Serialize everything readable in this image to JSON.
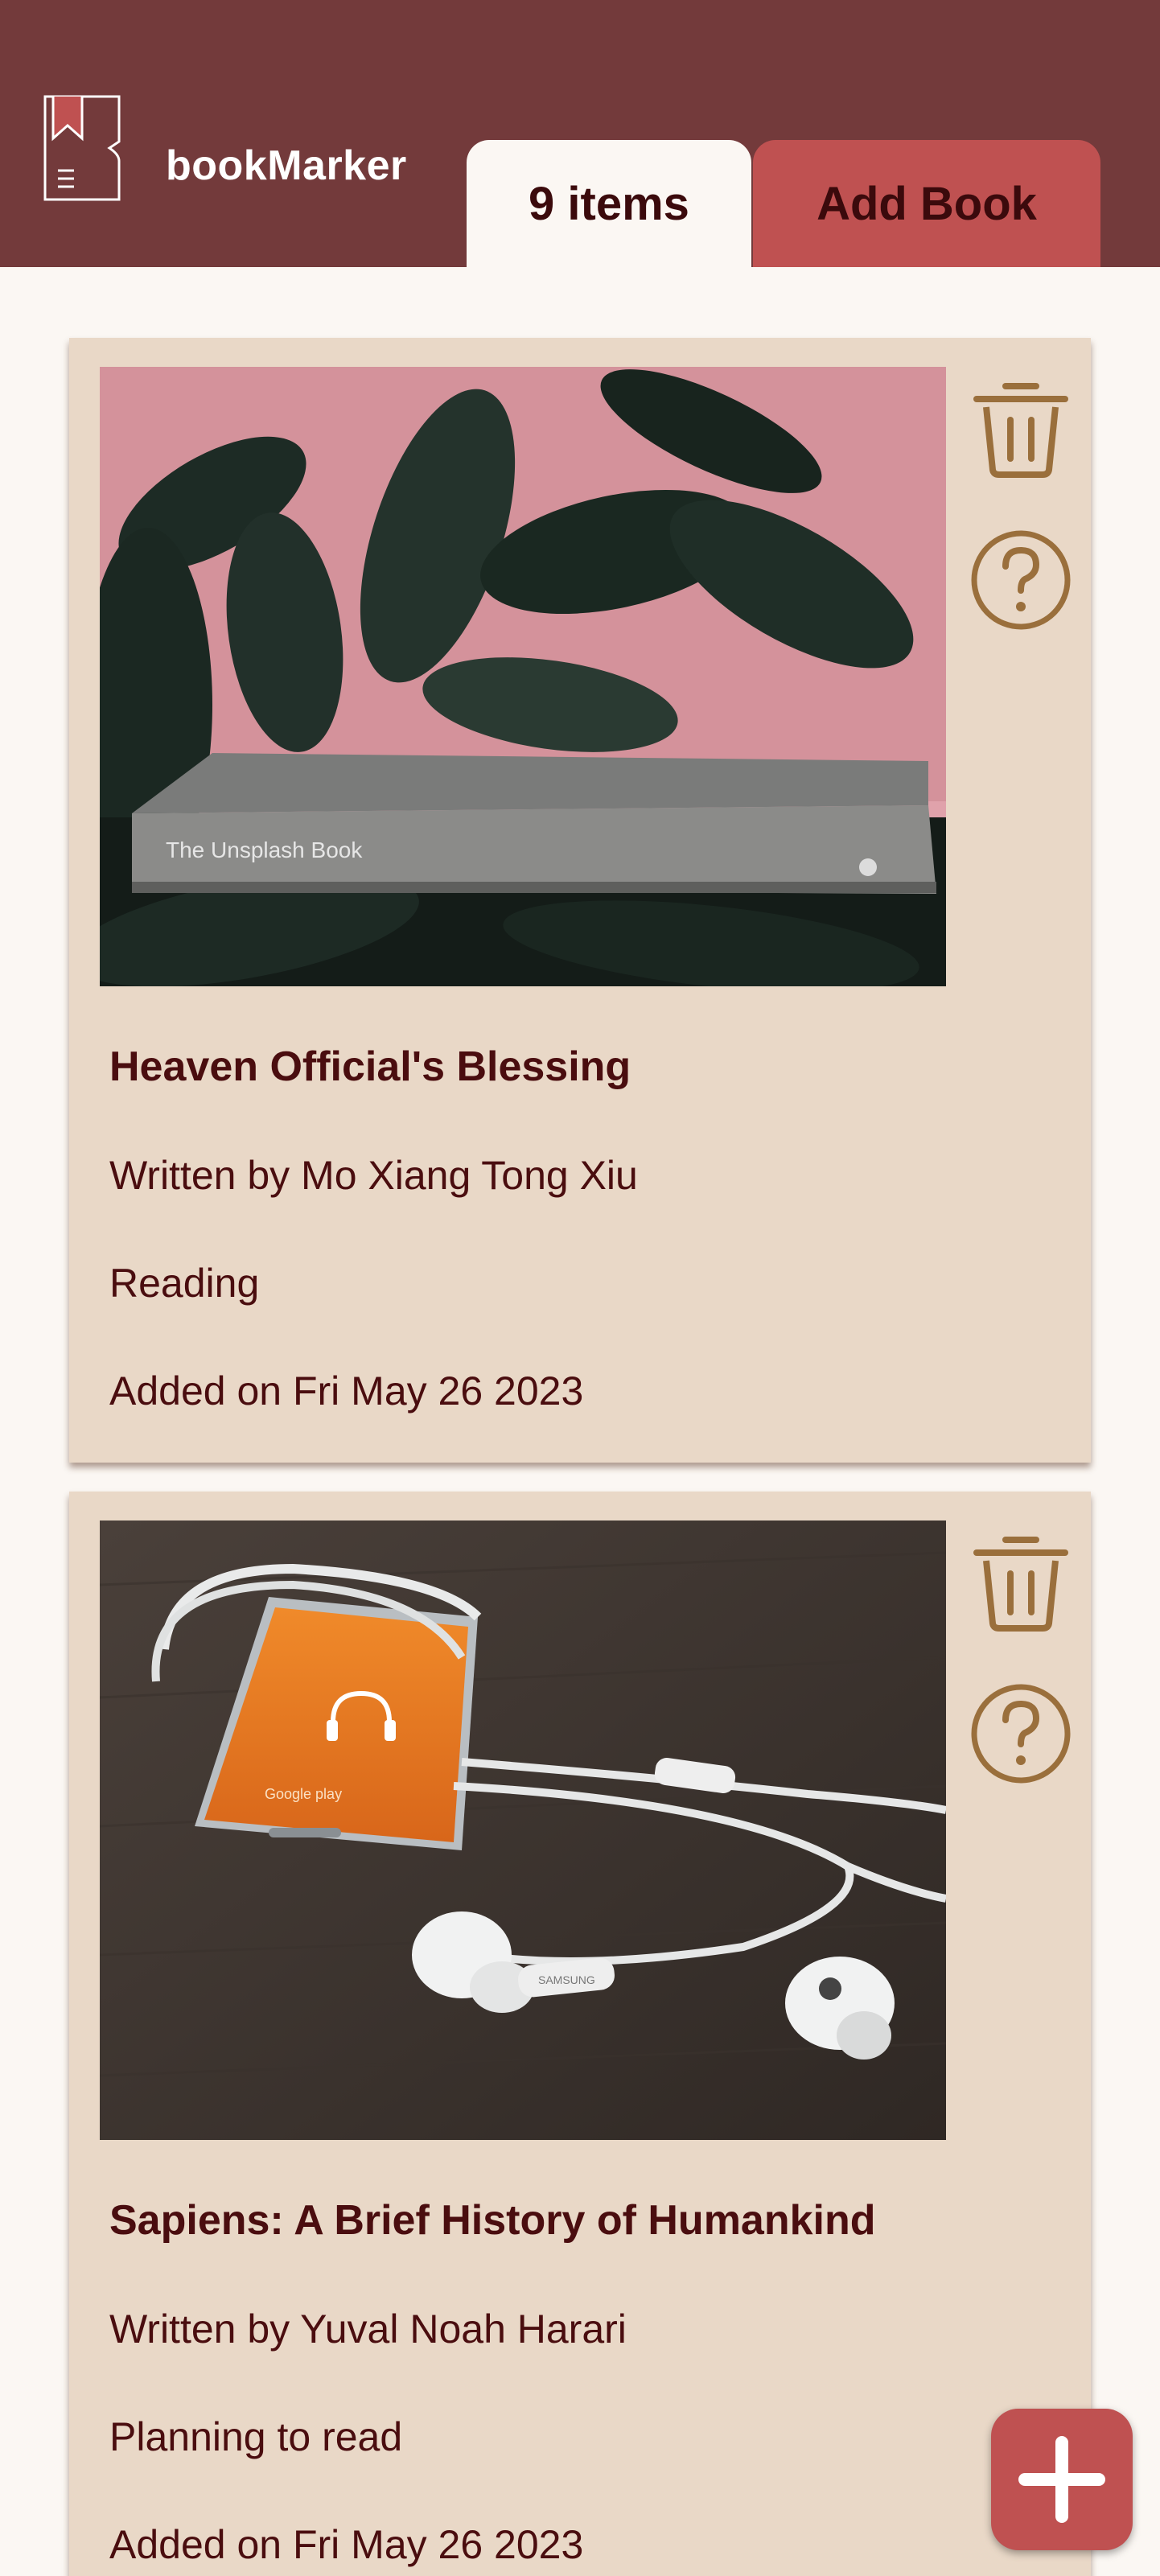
{
  "header": {
    "app_name": "bookMarker",
    "items_tab": "9 items",
    "add_tab": "Add Book"
  },
  "books": [
    {
      "title": "Heaven Official's Blessing",
      "author_line": "Written by Mo Xiang Tong Xiu",
      "status": "Reading",
      "added_line": "Added on Fri May 26 2023",
      "image_caption": "The Unsplash Book"
    },
    {
      "title": "Sapiens: A Brief History of Humankind",
      "author_line": "Written by Yuval Noah Harari",
      "status": "Planning to read",
      "added_line": "Added on Fri May 26 2023",
      "image_caption": "Google play",
      "image_brand": "SAMSUNG"
    }
  ],
  "icons": {
    "delete": "trash-icon",
    "info": "help-icon",
    "add": "plus-icon"
  },
  "colors": {
    "header_bg": "#733a3b",
    "accent": "#bf5151",
    "card_bg": "#e9d8c7",
    "icon_gold": "#9a6f3c",
    "text": "#4a0d0f"
  }
}
